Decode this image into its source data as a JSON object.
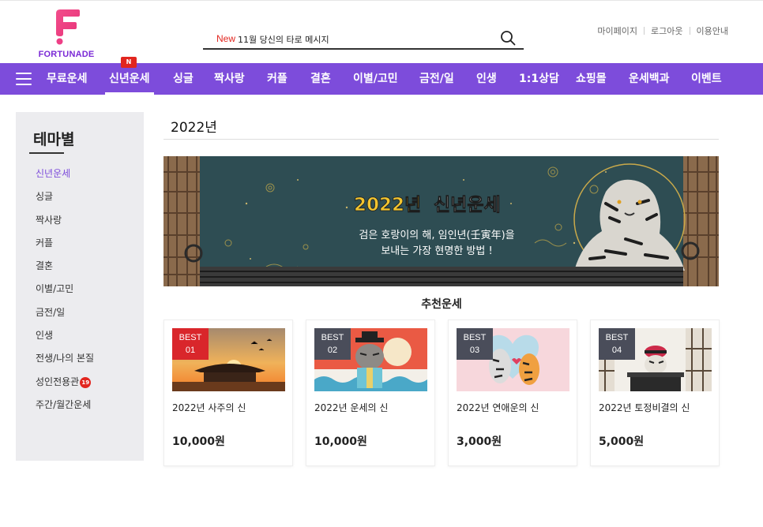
{
  "header": {
    "logo_text": "FORTUNADE",
    "search": {
      "new_label": "New",
      "text": "11월 당신의 타로 메시지"
    },
    "util_links": [
      "마이페이지",
      "로그아웃",
      "이용안내"
    ]
  },
  "nav": {
    "badge": "N",
    "items": [
      "무료운세",
      "신년운세",
      "싱글",
      "짝사랑",
      "커플",
      "결혼",
      "이별/고민",
      "금전/일",
      "인생",
      "1:1상담",
      "쇼핑몰",
      "운세백과",
      "이벤트"
    ],
    "active_index": 1
  },
  "sidebar": {
    "title": "테마별",
    "items": [
      "신년운세",
      "싱글",
      "짝사랑",
      "커플",
      "결혼",
      "이별/고민",
      "금전/일",
      "인생",
      "전생/나의 본질",
      "성인전용관",
      "주간/월간운세"
    ],
    "adult_badge": "19",
    "active_index": 0
  },
  "main": {
    "title": "2022년",
    "banner": {
      "headline_year": "2022년",
      "headline_rest": "신년운세",
      "line1": "검은 호랑이의 해, 임인년(壬寅年)을",
      "line2": "보내는 가장 현명한 방법 !"
    },
    "section_title": "추천운세",
    "cards": [
      {
        "best": "BEST",
        "rank": "01",
        "name": "2022년 사주의 신",
        "price": "10,000원"
      },
      {
        "best": "BEST",
        "rank": "02",
        "name": "2022년 운세의 신",
        "price": "10,000원"
      },
      {
        "best": "BEST",
        "rank": "03",
        "name": "2022년 연애운의 신",
        "price": "3,000원"
      },
      {
        "best": "BEST",
        "rank": "04",
        "name": "2022년 토정비결의 신",
        "price": "5,000원"
      }
    ]
  },
  "colors": {
    "brand_purple": "#7d4cdb",
    "badge_red": "#e2261f",
    "logo_pink": "#ee3f86"
  }
}
